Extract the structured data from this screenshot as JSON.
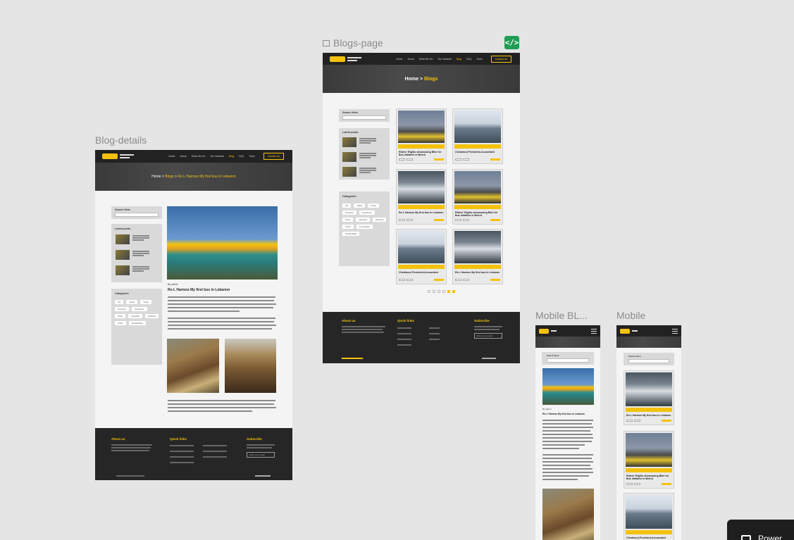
{
  "frames": {
    "blogs_page": "Blogs-page",
    "blog_details": "Blog-details",
    "mobile_blog": "Mobile BL...",
    "mobile": "Mobile"
  },
  "code_button": "</>",
  "power_button": "Power",
  "nav": {
    "links": [
      "Home",
      "About",
      "What We Do",
      "Our Network",
      "Blog",
      "FAQ",
      "Team"
    ],
    "cta": "Contact Us"
  },
  "blogs_page": {
    "crumb_home": "Home",
    "crumb_sep": ">",
    "crumb_current": "Blogs",
    "search_title": "Search Here",
    "latest_title": "Latest posts",
    "categories_title": "Categories",
    "categories": [
      "Tax",
      "Safety",
      "Travel",
      "Transport",
      "Operations",
      "Policy",
      "Networks",
      "Business",
      "Urban",
      "Accessibility",
      "Sustainability"
    ],
    "cards": [
      {
        "title": "Riders' Rights showcasing Bike for Bus initiative in Beirut"
      },
      {
        "title": "Chedmonj President-Accountant"
      },
      {
        "title": "Ro L Harmoz My first bus in Lebanon"
      },
      {
        "title": "Riders' Rights showcasing Bike for Bus initiative in Beirut"
      },
      {
        "title": "Chedmonj President-Accountant"
      },
      {
        "title": "Ro L Harmoz My first bus in Lebanon"
      }
    ],
    "footer": {
      "about": "About us",
      "quick": "Quick links",
      "subscribe": "Subscribe",
      "enter_email": "Enter your email"
    }
  },
  "blog_details": {
    "crumb_home": "Home",
    "crumb_blogs": "Blogs",
    "crumb_current": "Ro L Harmoz My first bus in Lebanon",
    "search_title": "Search Here",
    "latest_title": "Latest posts",
    "categories_title": "Categories",
    "post_meta": "By admin",
    "post_title": "Ro L Harmoz My first bus in Lebanon",
    "footer": {
      "about": "About us",
      "quick": "Quick links",
      "subscribe": "Subscribe",
      "enter_email": "Enter your email"
    }
  },
  "mobile_blog": {
    "search_title": "Search Here",
    "post_meta": "By admin",
    "post_title": "Ro L Harmoz My first bus in Lebanon"
  },
  "mobile": {
    "search_title": "Search Here",
    "cards": [
      {
        "title": "Ro L Harmoz My first bus in Lebanon"
      },
      {
        "title": "Riders' Rights showcasing Bike for Bus initiative in Beirut"
      },
      {
        "title": "Chedmonj President-Accountant"
      }
    ]
  }
}
